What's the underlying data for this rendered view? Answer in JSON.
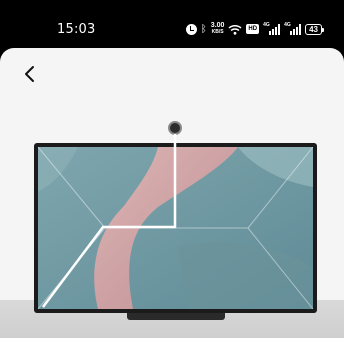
{
  "status_bar": {
    "time": "15:03",
    "net_speed_value": "3.00",
    "net_speed_unit": "KB/S",
    "hd_label": "HD",
    "sim1_label": "4G",
    "sim2_label": "4G",
    "battery": "43"
  },
  "icons": {
    "back": "chevron-left-icon",
    "alarm": "alarm-icon",
    "bluetooth": "bluetooth-icon",
    "wifi": "wifi-icon"
  },
  "colors": {
    "app_background": "#f5f5f5",
    "tv_bezel": "#1b1b1b",
    "guide_line": "#ffffff"
  }
}
